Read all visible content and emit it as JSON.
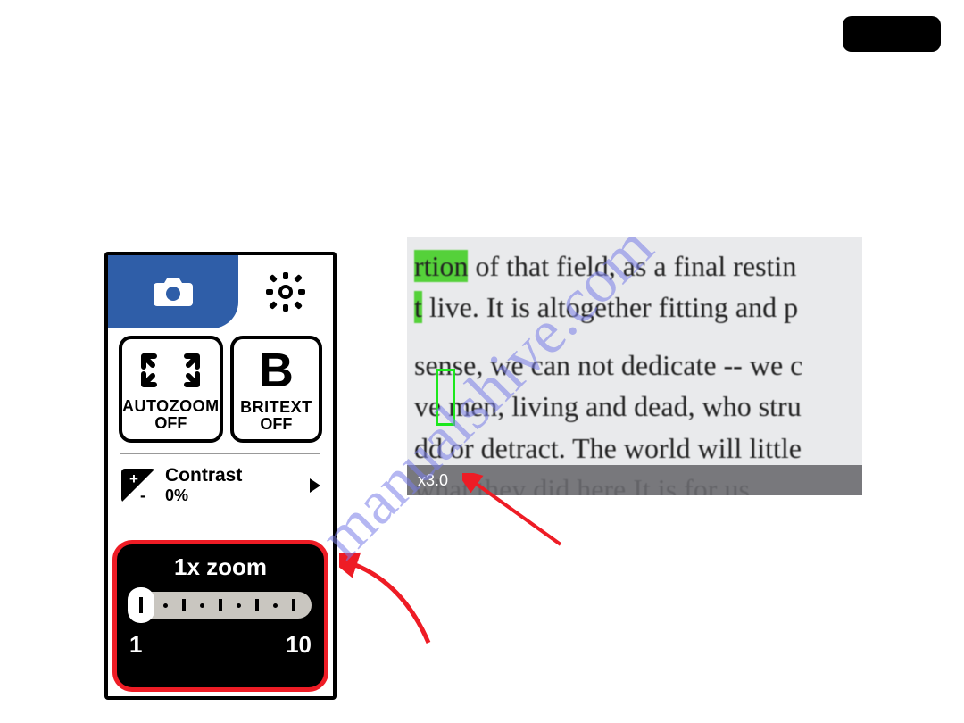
{
  "page_pill": "",
  "watermark": "manualshive.com",
  "panel": {
    "camera_icon": "camera-icon",
    "gear_icon": "gear-icon",
    "autozoom": {
      "title": "AUTOZOOM",
      "state": "OFF"
    },
    "britext": {
      "title": "BRITEXT",
      "state": "OFF"
    },
    "contrast": {
      "label": "Contrast",
      "value": "0%"
    },
    "zoom": {
      "title": "1x zoom",
      "min": "1",
      "max": "10"
    }
  },
  "preview": {
    "lines": {
      "l1a": "rtion",
      "l1b": " of that field, as a final restin",
      "l2a": "t",
      "l2b": " live. It is altogether fitting and p",
      "l3": "sense, we can not dedicate -- we c",
      "l4a": "v",
      "l4b": "e men, living and dead, who stru",
      "l5a": "d",
      "l5b": "d or detract. The world will little",
      "l6": "what they did here  It is for us"
    },
    "zoom_label": "x3.0"
  }
}
